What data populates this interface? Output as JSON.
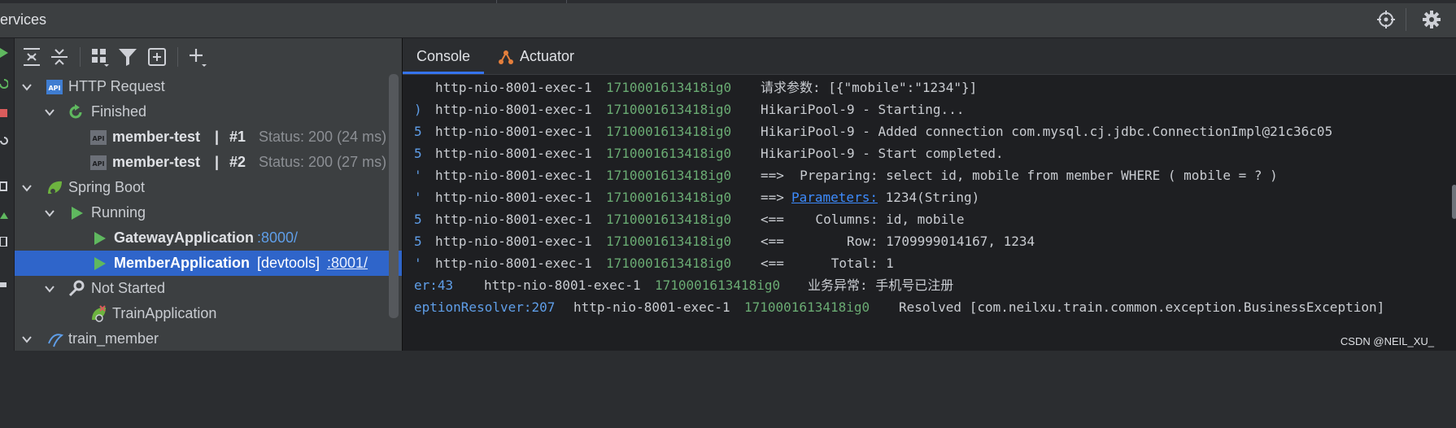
{
  "window": {
    "title": "ervices"
  },
  "tree": {
    "nodes": {
      "http_request": "HTTP Request",
      "finished": "Finished",
      "req1_name": "member-test",
      "req1_sep": "|",
      "req1_num": "#1",
      "req1_status": "Status: 200 (24 ms)",
      "req2_name": "member-test",
      "req2_sep": "|",
      "req2_num": "#2",
      "req2_status": "Status: 200 (27 ms)",
      "spring_boot": "Spring Boot",
      "running": "Running",
      "gateway_name": "GatewayApplication",
      "gateway_port": ":8000/",
      "member_name": "MemberApplication",
      "member_tag": "[devtools]",
      "member_port": ":8001/",
      "not_started": "Not Started",
      "train_app": "TrainApplication",
      "train_member": "train_member"
    }
  },
  "console": {
    "tabs": [
      "Console",
      "Actuator"
    ],
    "active_tab": "Console",
    "lines": [
      {
        "gutter": "",
        "thread": "http-nio-8001-exec-1",
        "trace": "1710001613418ig0",
        "message": "请求参数: [{\"mobile\":\"1234\"}]"
      },
      {
        "gutter": ")",
        "thread": "http-nio-8001-exec-1",
        "trace": "1710001613418ig0",
        "message": "HikariPool-9 - Starting..."
      },
      {
        "gutter": "5",
        "thread": "http-nio-8001-exec-1",
        "trace": "1710001613418ig0",
        "message": "HikariPool-9 - Added connection com.mysql.cj.jdbc.ConnectionImpl@21c36c05"
      },
      {
        "gutter": "5",
        "thread": "http-nio-8001-exec-1",
        "trace": "1710001613418ig0",
        "message": "HikariPool-9 - Start completed."
      },
      {
        "gutter": "'",
        "thread": "http-nio-8001-exec-1",
        "trace": "1710001613418ig0",
        "message": "==>  Preparing: select id, mobile from member WHERE ( mobile = ? )"
      },
      {
        "gutter": "'",
        "thread": "http-nio-8001-exec-1",
        "trace": "1710001613418ig0",
        "message_prefix": "==> ",
        "message_link": "Parameters:",
        "message_suffix": " 1234(String)"
      },
      {
        "gutter": "5",
        "thread": "http-nio-8001-exec-1",
        "trace": "1710001613418ig0",
        "message": "<==    Columns: id, mobile"
      },
      {
        "gutter": "5",
        "thread": "http-nio-8001-exec-1",
        "trace": "1710001613418ig0",
        "message": "<==        Row: 1709999014167, 1234"
      },
      {
        "gutter": "'",
        "thread": "http-nio-8001-exec-1",
        "trace": "1710001613418ig0",
        "message": "<==      Total: 1"
      },
      {
        "source": "er:43",
        "thread": "http-nio-8001-exec-1",
        "trace": "1710001613418ig0",
        "message": "业务异常: 手机号已注册"
      },
      {
        "source": "eptionResolver:207",
        "thread": "http-nio-8001-exec-1",
        "trace": "1710001613418ig0",
        "message": "Resolved [com.neilxu.train.common.exception.BusinessException]"
      }
    ]
  },
  "watermark": "CSDN @NEIL_XU_",
  "icons": {
    "locate": "crosshair-icon",
    "settings": "gear-icon"
  }
}
